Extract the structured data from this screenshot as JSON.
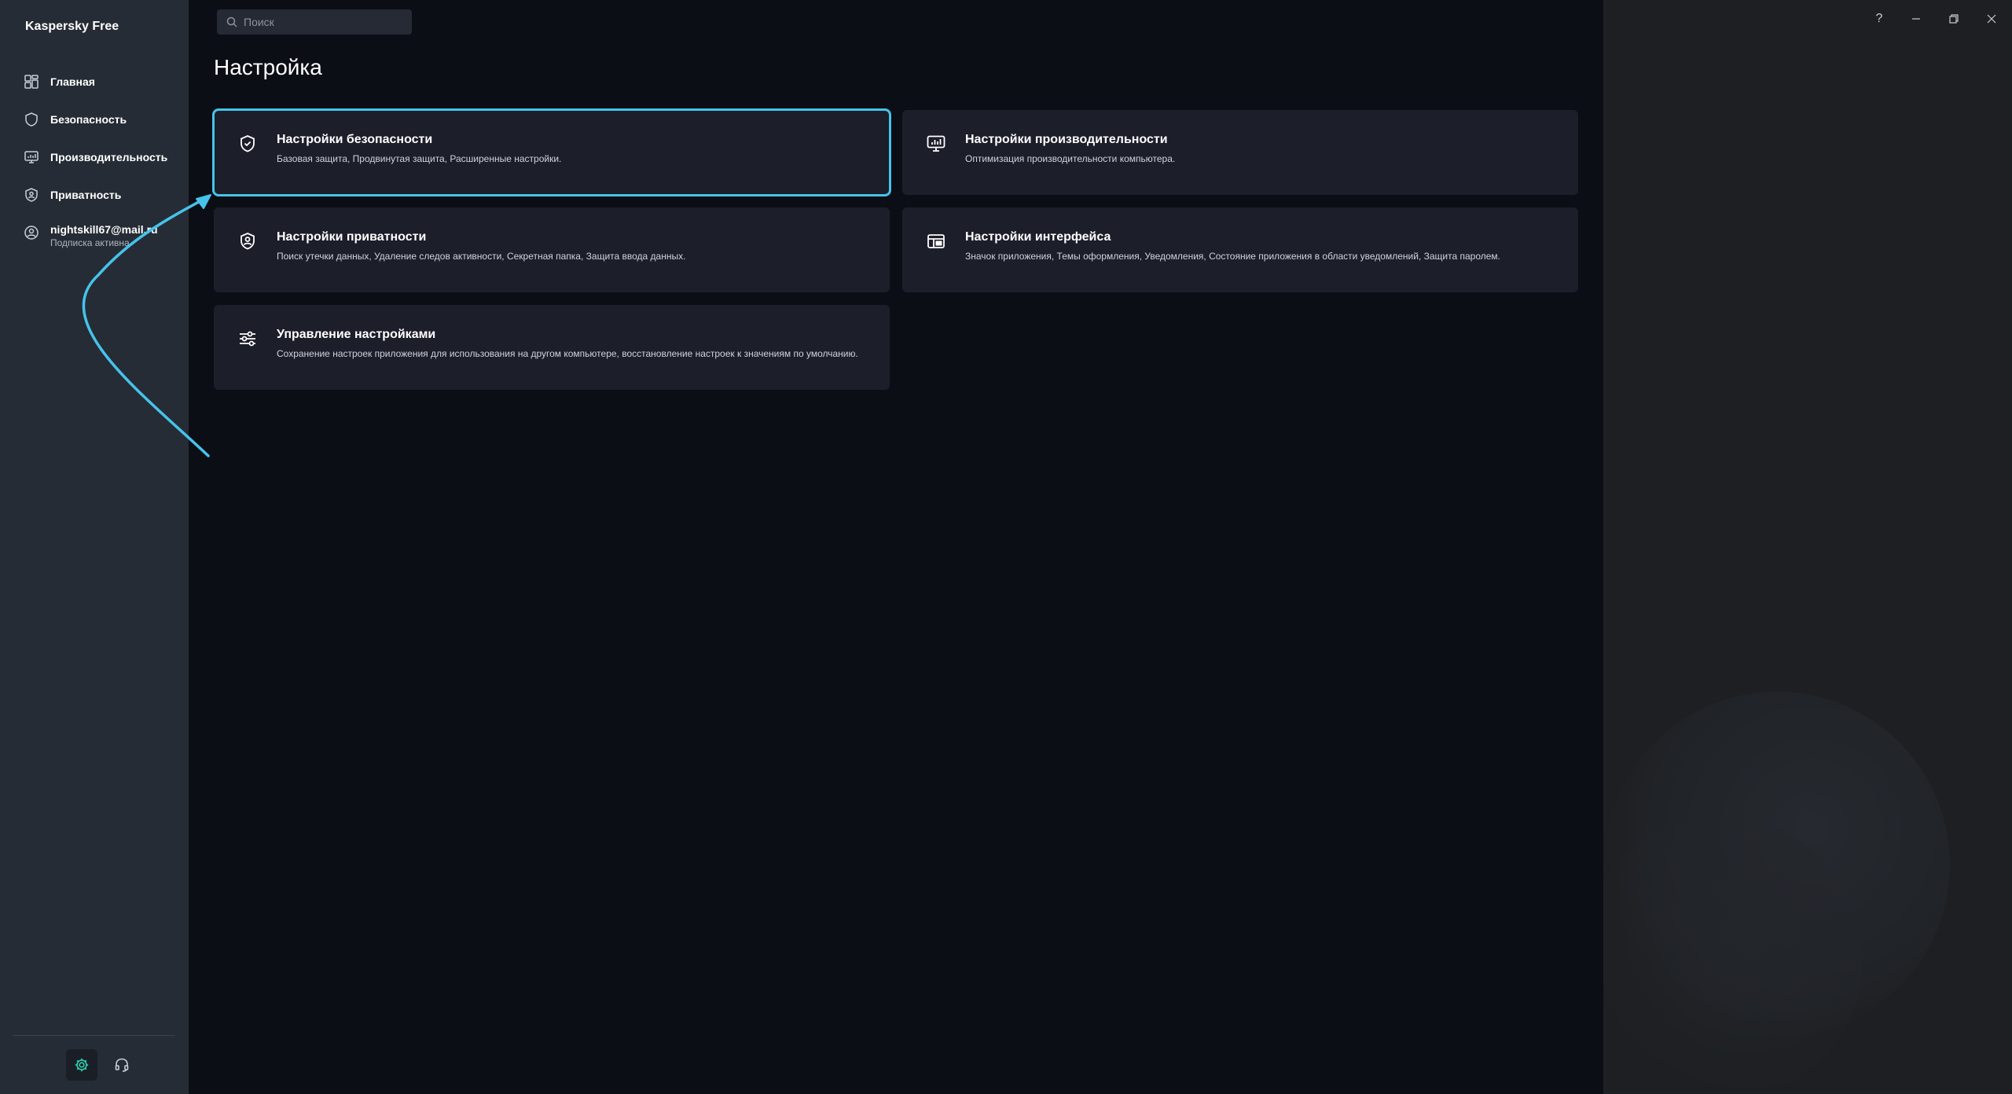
{
  "app": {
    "name": "Kaspersky Free"
  },
  "sidebar": {
    "items": [
      {
        "id": "home",
        "label": "Главная",
        "icon": "grid-icon"
      },
      {
        "id": "security",
        "label": "Безопасность",
        "icon": "shield-icon"
      },
      {
        "id": "performance",
        "label": "Производительность",
        "icon": "monitor-icon"
      },
      {
        "id": "privacy",
        "label": "Приватность",
        "icon": "privacy-shield-icon"
      }
    ],
    "account": {
      "email": "nightskill67@mail.ru",
      "status": "Подписка активна",
      "icon": "user-circle-icon"
    },
    "footer": {
      "settings_icon": "gear-icon",
      "support_icon": "headset-icon",
      "accent": "#2fd4b4"
    }
  },
  "search": {
    "placeholder": "Поиск",
    "value": ""
  },
  "page": {
    "title": "Настройка"
  },
  "cards": [
    {
      "id": "security",
      "title": "Настройки безопасности",
      "desc": "Базовая защита, Продвинутая защита, Расширенные настройки.",
      "icon": "shield-check-icon",
      "selected": true
    },
    {
      "id": "performance",
      "title": "Настройки производительности",
      "desc": "Оптимизация производительности компьютера.",
      "icon": "monitor-chart-icon"
    },
    {
      "id": "privacy",
      "title": "Настройки приватности",
      "desc": "Поиск утечки данных, Удаление следов активности, Секретная папка, Защита ввода данных.",
      "icon": "privacy-shield-icon"
    },
    {
      "id": "interface",
      "title": "Настройки интерфейса",
      "desc": "Значок приложения, Темы оформления, Уведомления, Состояние приложения в области уведомлений, Защита паролем.",
      "icon": "layout-icon"
    },
    {
      "id": "manage",
      "title": "Управление настройками",
      "desc": "Сохранение настроек приложения для использования на другом компьютере, восстановление настроек к значениям по умолчанию.",
      "icon": "sliders-icon"
    }
  ],
  "window": {
    "help": "?",
    "minimize_icon": "minimize-icon",
    "restore_icon": "restore-icon",
    "close_icon": "close-icon"
  },
  "colors": {
    "highlight": "#46c3ea",
    "sidebar": "#262c35",
    "main": "#0c0e16",
    "card": "#1c1e2a"
  }
}
